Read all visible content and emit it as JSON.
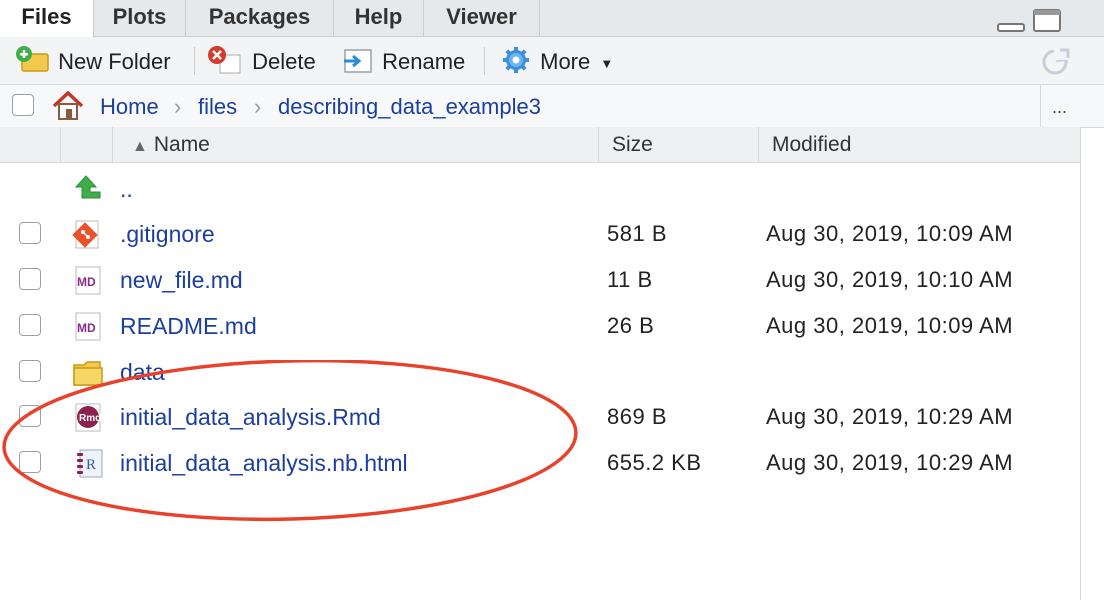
{
  "tabs": [
    {
      "label": "Files",
      "active": true
    },
    {
      "label": "Plots",
      "active": false
    },
    {
      "label": "Packages",
      "active": false
    },
    {
      "label": "Help",
      "active": false
    },
    {
      "label": "Viewer",
      "active": false
    }
  ],
  "toolbar": {
    "new_folder": "New Folder",
    "delete": "Delete",
    "rename": "Rename",
    "more": "More"
  },
  "breadcrumb": {
    "home": "Home",
    "parts": [
      "files",
      "describing_data_example3"
    ],
    "overflow": "..."
  },
  "columns": {
    "name": "Name",
    "size": "Size",
    "modified": "Modified",
    "sort": "ascending"
  },
  "files": [
    {
      "name": "..",
      "size": "",
      "modified": "",
      "icon": "up-arrow-icon"
    },
    {
      "name": ".gitignore",
      "size": "581 B",
      "modified": "Aug 30, 2019, 10:09 AM",
      "icon": "git-file-icon"
    },
    {
      "name": "new_file.md",
      "size": "11 B",
      "modified": "Aug 30, 2019, 10:10 AM",
      "icon": "markdown-file-icon"
    },
    {
      "name": "README.md",
      "size": "26 B",
      "modified": "Aug 30, 2019, 10:09 AM",
      "icon": "markdown-file-icon"
    },
    {
      "name": "data",
      "size": "",
      "modified": "",
      "icon": "folder-icon"
    },
    {
      "name": "initial_data_analysis.Rmd",
      "size": "869 B",
      "modified": "Aug 30, 2019, 10:29 AM",
      "icon": "rmd-file-icon"
    },
    {
      "name": "initial_data_analysis.nb.html",
      "size": "655.2 KB",
      "modified": "Aug 30, 2019, 10:29 AM",
      "icon": "r-notebook-file-icon"
    }
  ],
  "colors": {
    "link": "#1c3f9e",
    "annotation": "#e8412c"
  }
}
